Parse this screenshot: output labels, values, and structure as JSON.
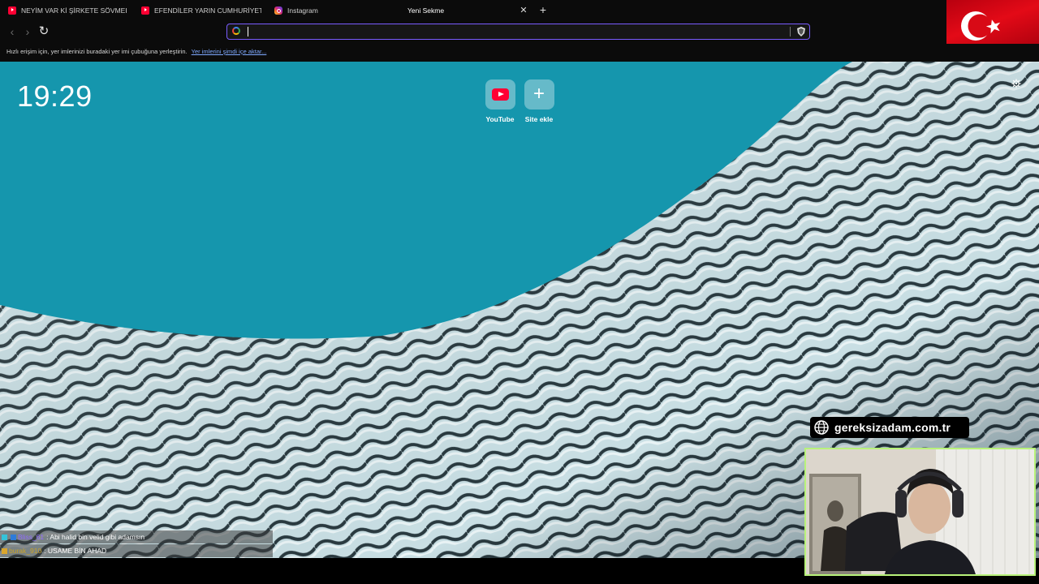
{
  "tabs": [
    {
      "title": "NEYİM VAR Kİ ŞİRKETE SÖVMEKTEN...",
      "icon": "youtube-icon"
    },
    {
      "title": "EFENDİLER YARIN CUMHURİYETİ İLAN...",
      "icon": "youtube-icon"
    },
    {
      "title": "Instagram",
      "icon": "instagram-icon"
    },
    {
      "title": "Yeni Sekme",
      "active": true
    }
  ],
  "omnibox": {
    "value": "",
    "placeholder": ""
  },
  "bookmarks_bar": {
    "message": "Hızlı erişim için, yer imlerinizi buradaki yer imi çubuğuna yerleştirin.",
    "import_link": "Yer imlerini şimdi içe aktar..."
  },
  "newtab": {
    "clock": "19:29",
    "shortcuts": [
      {
        "label": "YouTube",
        "icon": "youtube-icon"
      },
      {
        "label": "Site ekle",
        "icon": "plus-icon"
      }
    ]
  },
  "chat": [
    {
      "user": "Bliss_61",
      "message": ": Abi halid bin velid gibi adamsın"
    },
    {
      "user": "burak_910",
      "message": ": USAME BİN AHAD"
    }
  ],
  "stream_overlay": {
    "site": "gereksizadam.com.tr"
  },
  "colors": {
    "accent": "#7a5cff",
    "page_bg": "#1596ad",
    "webcam_border": "#b8f27a",
    "flag_red": "#e30a17"
  }
}
